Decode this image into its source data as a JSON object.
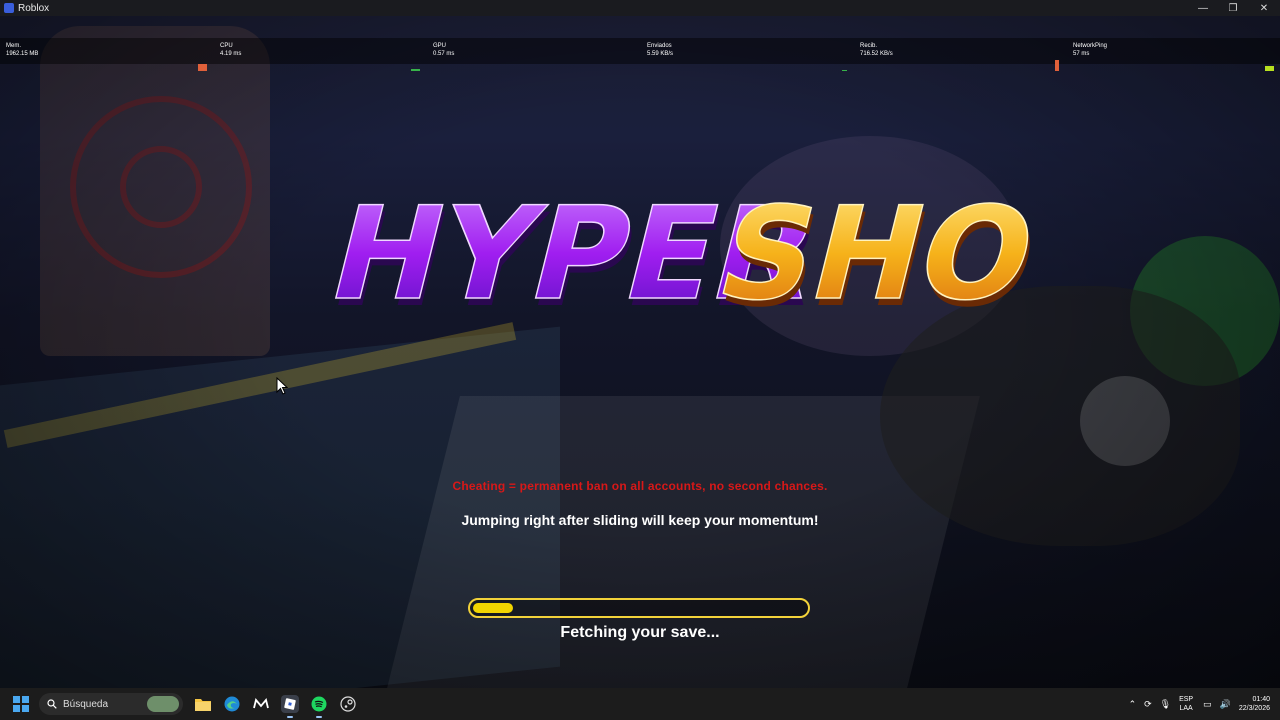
{
  "window": {
    "title": "Roblox",
    "minimize_glyph": "—",
    "maximize_glyph": "❐",
    "close_glyph": "✕"
  },
  "stats": [
    {
      "label": "Mem.",
      "value": "1962.15 MB",
      "color": "#ffffff"
    },
    {
      "label": "CPU",
      "value": "4.19 ms",
      "color": "#e0603a"
    },
    {
      "label": "GPU",
      "value": "0.57 ms",
      "color": "#37b34a"
    },
    {
      "label": "Enviados",
      "value": "5.59 KB/s",
      "color": "#ffffff"
    },
    {
      "label": "Recib.",
      "value": "716.52 KB/s",
      "color": "#37b34a"
    },
    {
      "label": "NetworkPing",
      "value": "57 ms",
      "color": "#e0603a"
    }
  ],
  "logo": {
    "part1": "HYPER",
    "part2": "SHOT"
  },
  "warning_text": "Cheating = permanent ban on all accounts, no second chances.",
  "tip_text": "Jumping right after sliding will keep your momentum!",
  "loading": {
    "progress": 0.12,
    "status": "Fetching your save..."
  },
  "taskbar": {
    "search_placeholder": "Búsqueda",
    "apps": [
      "file-explorer-icon",
      "edge-icon",
      "epic-icon",
      "roblox-icon",
      "spotify-icon",
      "steam-icon"
    ],
    "tray": {
      "lang_top": "ESP",
      "lang_bottom": "LAA",
      "time": "01:40",
      "date": "22/3/2026"
    }
  },
  "colors": {
    "warning": "#d81818",
    "progress": "#f2d500",
    "logo_purple": "#b020f0",
    "logo_orange": "#f6a814"
  }
}
